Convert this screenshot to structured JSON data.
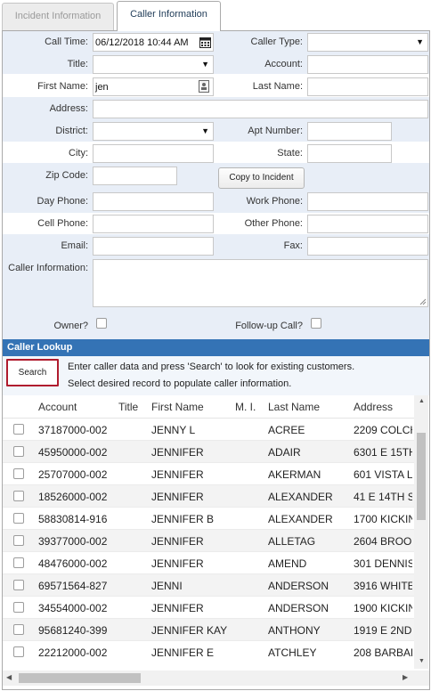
{
  "tabs": [
    {
      "label": "Incident Information",
      "active": false
    },
    {
      "label": "Caller Information",
      "active": true
    }
  ],
  "form": {
    "call_time_label": "Call Time:",
    "call_time_value": "06/12/2018 10:44 AM",
    "caller_type_label": "Caller Type:",
    "caller_type_value": "",
    "title_label": "Title:",
    "title_value": "",
    "account_label": "Account:",
    "account_value": "",
    "first_name_label": "First Name:",
    "first_name_value": "jen",
    "last_name_label": "Last Name:",
    "last_name_value": "",
    "address_label": "Address:",
    "address_value": "",
    "district_label": "District:",
    "district_value": "",
    "apt_number_label": "Apt Number:",
    "apt_number_value": "",
    "city_label": "City:",
    "city_value": "",
    "state_label": "State:",
    "state_value": "",
    "zip_code_label": "Zip Code:",
    "zip_code_value": "",
    "copy_button_label": "Copy to Incident",
    "day_phone_label": "Day Phone:",
    "day_phone_value": "",
    "work_phone_label": "Work Phone:",
    "work_phone_value": "",
    "cell_phone_label": "Cell Phone:",
    "cell_phone_value": "",
    "other_phone_label": "Other Phone:",
    "other_phone_value": "",
    "email_label": "Email:",
    "email_value": "",
    "fax_label": "Fax:",
    "fax_value": "",
    "caller_info_label": "Caller Information:",
    "caller_info_value": "",
    "owner_label": "Owner?",
    "owner_checked": false,
    "followup_label": "Follow-up Call?",
    "followup_checked": false
  },
  "lookup": {
    "section_title": "Caller Lookup",
    "search_button_label": "Search",
    "instruction_1": "Enter caller data and press 'Search' to look for existing customers.",
    "instruction_2": "Select desired record to populate caller information.",
    "columns": [
      "Account",
      "Title",
      "First Name",
      "M. I.",
      "Last Name",
      "Address"
    ],
    "rows": [
      {
        "account": "37187000-002",
        "title": "",
        "first_name": "JENNY L",
        "mi": "",
        "last_name": "ACREE",
        "address": "2209 COLCH"
      },
      {
        "account": "45950000-002",
        "title": "",
        "first_name": "JENNIFER",
        "mi": "",
        "last_name": "ADAIR",
        "address": "6301 E 15TH"
      },
      {
        "account": "25707000-002",
        "title": "",
        "first_name": "JENNIFER",
        "mi": "",
        "last_name": "AKERMAN",
        "address": "601 VISTA LN"
      },
      {
        "account": "18526000-002",
        "title": "",
        "first_name": "JENNIFER",
        "mi": "",
        "last_name": "ALEXANDER",
        "address": "41 E 14TH ST"
      },
      {
        "account": "58830814-916",
        "title": "",
        "first_name": "JENNIFER B",
        "mi": "",
        "last_name": "ALEXANDER",
        "address": "1700 KICKIN"
      },
      {
        "account": "39377000-002",
        "title": "",
        "first_name": "JENNIFER",
        "mi": "",
        "last_name": "ALLETAG",
        "address": "2604 BROOK"
      },
      {
        "account": "48476000-002",
        "title": "",
        "first_name": "JENNIFER",
        "mi": "",
        "last_name": "AMEND",
        "address": "301 DENNIS"
      },
      {
        "account": "69571564-827",
        "title": "",
        "first_name": "JENNI",
        "mi": "",
        "last_name": "ANDERSON",
        "address": "3916 WHITE"
      },
      {
        "account": "34554000-002",
        "title": "",
        "first_name": "JENNIFER",
        "mi": "",
        "last_name": "ANDERSON",
        "address": "1900 KICKIN"
      },
      {
        "account": "95681240-399",
        "title": "",
        "first_name": "JENNIFER KAY",
        "mi": "",
        "last_name": "ANTHONY",
        "address": "1919 E 2ND"
      },
      {
        "account": "22212000-002",
        "title": "",
        "first_name": "JENNIFER E",
        "mi": "",
        "last_name": "ATCHLEY",
        "address": "208 BARBAR"
      }
    ]
  },
  "colors": {
    "accent": "#3473b5",
    "band": "#e8eef7",
    "search_border": "#b01c2e"
  }
}
